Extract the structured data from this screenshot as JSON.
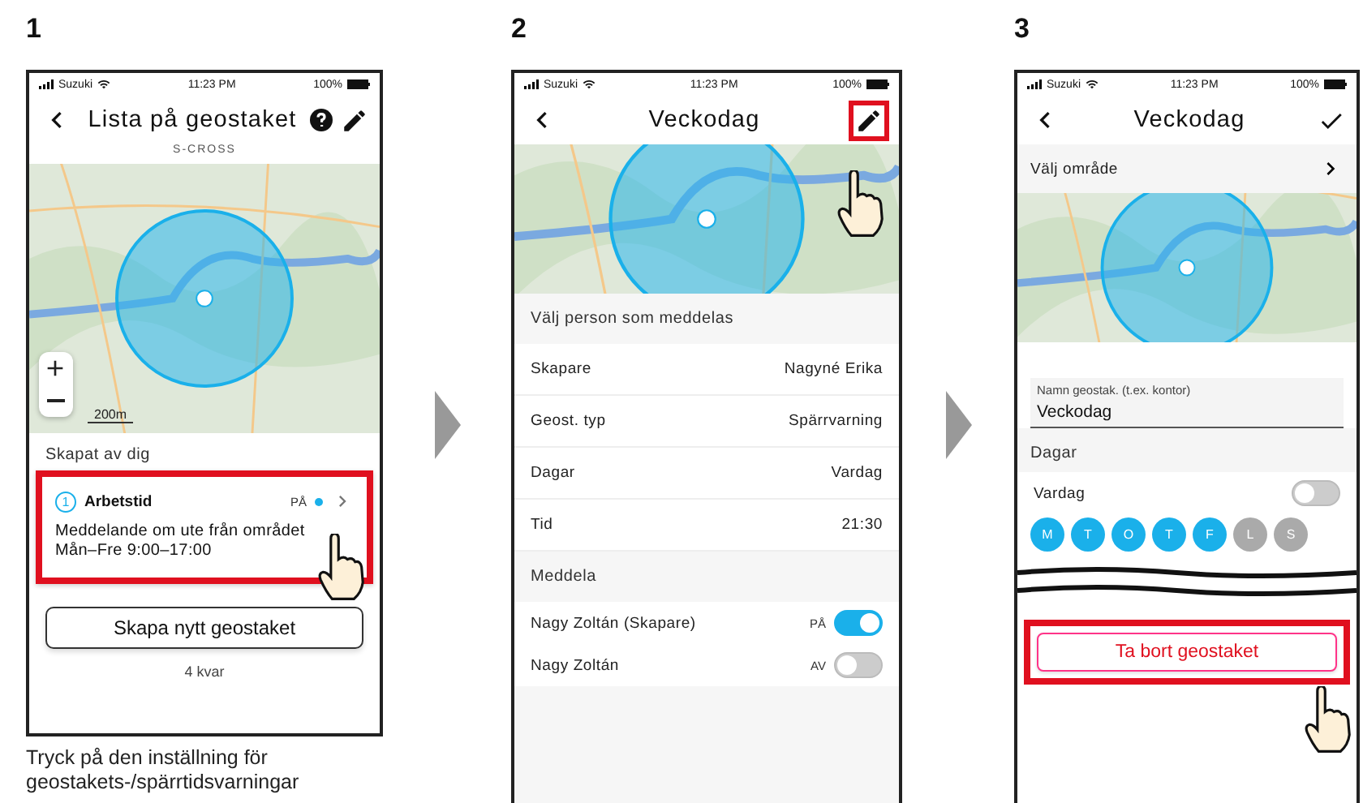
{
  "steps": [
    {
      "number": "1",
      "kind": "fence_list",
      "status_bar": {
        "carrier": "Suzuki",
        "time": "11:23 PM",
        "battery": "100%"
      },
      "header": {
        "title": "Lista på geostaket",
        "subtitle": "S-CROSS",
        "help": true,
        "action": {
          "kind": "edit"
        }
      },
      "map": {
        "scale": "200m",
        "zoom_controls": true
      },
      "section": "Skapat av dig",
      "fence": {
        "number": "1",
        "name": "Arbetstid",
        "state": "PÅ",
        "on": true,
        "description": "Meddelande om ute från området",
        "schedule": "Mån–Fre 9:00–17:00",
        "highlighted": true
      },
      "button": "Skapa nytt geostaket",
      "remaining": "4 kvar",
      "caption": "Tryck på den inställning för geostakets-/spärrtidsvarningar"
    },
    {
      "number": "2",
      "kind": "fence_detail",
      "status_bar": {
        "carrier": "Suzuki",
        "time": "11:23 PM",
        "battery": "100%"
      },
      "header": {
        "title": "Veckodag",
        "action": {
          "kind": "edit",
          "highlighted": true
        }
      },
      "sections": [
        {
          "title": "Välj person som meddelas",
          "rows": [
            {
              "kind": "value",
              "label": "Skapare",
              "value": "Nagyné Erika"
            },
            {
              "kind": "value",
              "label": "Geost. typ",
              "value": "Spärrvarning"
            },
            {
              "kind": "value",
              "label": "Dagar",
              "value": "Vardag"
            },
            {
              "kind": "value",
              "label": "Tid",
              "value": "21:30"
            }
          ]
        },
        {
          "title": "Meddela",
          "rows": [
            {
              "kind": "toggle",
              "label": "Nagy Zoltán (Skapare)",
              "state": "PÅ",
              "on": true
            },
            {
              "kind": "toggle",
              "label": "Nagy Zoltán",
              "state": "AV",
              "on": false
            }
          ]
        }
      ]
    },
    {
      "number": "3",
      "kind": "fence_edit",
      "status_bar": {
        "carrier": "Suzuki",
        "time": "11:23 PM",
        "battery": "100%"
      },
      "header": {
        "title": "Veckodag",
        "action": {
          "kind": "check"
        }
      },
      "area_row": "Välj område",
      "name_field": {
        "label": "Namn geostak. (t.ex. kontor)",
        "value": "Veckodag"
      },
      "days_section": "Dagar",
      "weekday_toggle": {
        "label": "Vardag",
        "on": false
      },
      "days": [
        {
          "letter": "M",
          "selected": true
        },
        {
          "letter": "T",
          "selected": true
        },
        {
          "letter": "O",
          "selected": true
        },
        {
          "letter": "T",
          "selected": true
        },
        {
          "letter": "F",
          "selected": true
        },
        {
          "letter": "L",
          "selected": false
        },
        {
          "letter": "S",
          "selected": false
        }
      ],
      "delete_button": {
        "label": "Ta bort geostaket",
        "highlighted": true
      }
    }
  ]
}
